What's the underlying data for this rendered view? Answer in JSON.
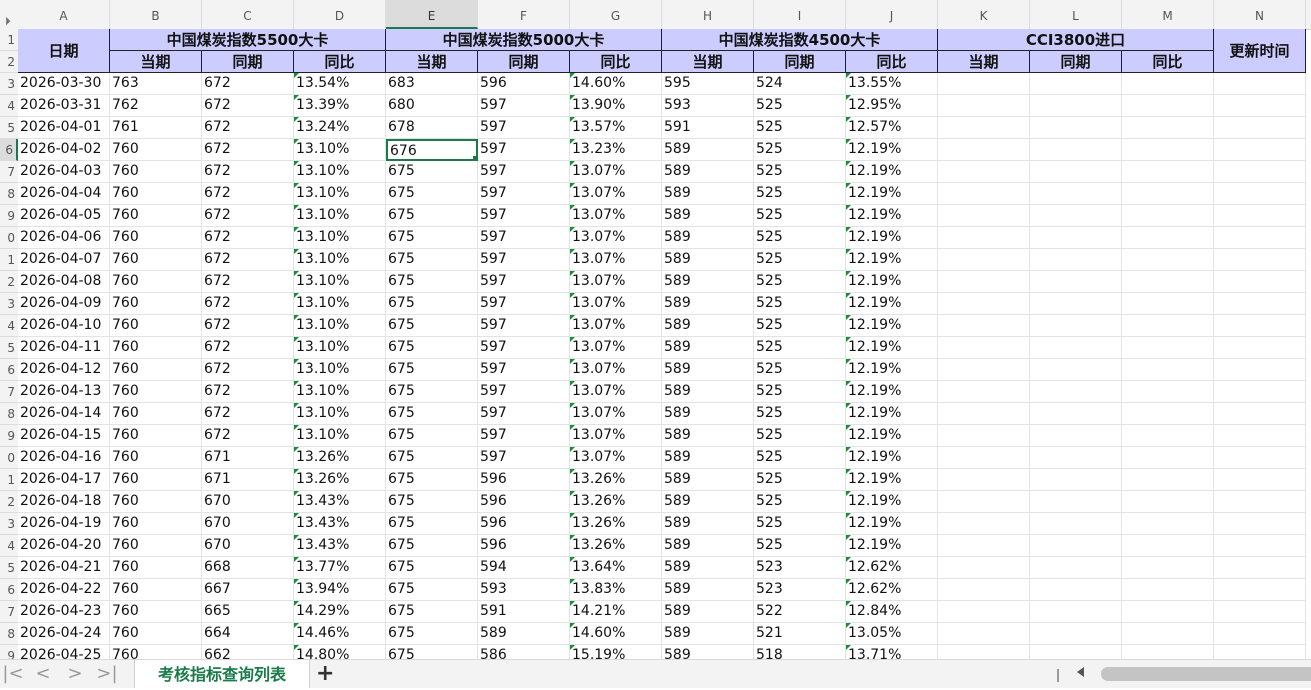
{
  "columns": [
    "A",
    "B",
    "C",
    "D",
    "E",
    "F",
    "G",
    "H",
    "I",
    "J",
    "K",
    "L",
    "M",
    "N"
  ],
  "selected_column": "E",
  "row_numbers": [
    "1",
    "2",
    "3",
    "4",
    "5",
    "6",
    "7",
    "8",
    "9",
    "0",
    "1",
    "2",
    "3",
    "4",
    "5",
    "6",
    "7",
    "8",
    "9",
    "0",
    "1",
    "2",
    "3",
    "4",
    "5",
    "6",
    "7",
    "8",
    "9"
  ],
  "selected_row_index": 5,
  "header": {
    "date": "日期",
    "group1": "中国煤炭指数5500大卡",
    "group2": "中国煤炭指数5000大卡",
    "group3": "中国煤炭指数4500大卡",
    "group4": "CCI3800进口",
    "update_time": "更新时间",
    "current": "当期",
    "same_period": "同期",
    "yoy": "同比"
  },
  "rows": [
    [
      "2026-03-30",
      "763",
      "672",
      "13.54%",
      "683",
      "596",
      "14.60%",
      "595",
      "524",
      "13.55%"
    ],
    [
      "2026-03-31",
      "762",
      "672",
      "13.39%",
      "680",
      "597",
      "13.90%",
      "593",
      "525",
      "12.95%"
    ],
    [
      "2026-04-01",
      "761",
      "672",
      "13.24%",
      "678",
      "597",
      "13.57%",
      "591",
      "525",
      "12.57%"
    ],
    [
      "2026-04-02",
      "760",
      "672",
      "13.10%",
      "676",
      "597",
      "13.23%",
      "589",
      "525",
      "12.19%"
    ],
    [
      "2026-04-03",
      "760",
      "672",
      "13.10%",
      "675",
      "597",
      "13.07%",
      "589",
      "525",
      "12.19%"
    ],
    [
      "2026-04-04",
      "760",
      "672",
      "13.10%",
      "675",
      "597",
      "13.07%",
      "589",
      "525",
      "12.19%"
    ],
    [
      "2026-04-05",
      "760",
      "672",
      "13.10%",
      "675",
      "597",
      "13.07%",
      "589",
      "525",
      "12.19%"
    ],
    [
      "2026-04-06",
      "760",
      "672",
      "13.10%",
      "675",
      "597",
      "13.07%",
      "589",
      "525",
      "12.19%"
    ],
    [
      "2026-04-07",
      "760",
      "672",
      "13.10%",
      "675",
      "597",
      "13.07%",
      "589",
      "525",
      "12.19%"
    ],
    [
      "2026-04-08",
      "760",
      "672",
      "13.10%",
      "675",
      "597",
      "13.07%",
      "589",
      "525",
      "12.19%"
    ],
    [
      "2026-04-09",
      "760",
      "672",
      "13.10%",
      "675",
      "597",
      "13.07%",
      "589",
      "525",
      "12.19%"
    ],
    [
      "2026-04-10",
      "760",
      "672",
      "13.10%",
      "675",
      "597",
      "13.07%",
      "589",
      "525",
      "12.19%"
    ],
    [
      "2026-04-11",
      "760",
      "672",
      "13.10%",
      "675",
      "597",
      "13.07%",
      "589",
      "525",
      "12.19%"
    ],
    [
      "2026-04-12",
      "760",
      "672",
      "13.10%",
      "675",
      "597",
      "13.07%",
      "589",
      "525",
      "12.19%"
    ],
    [
      "2026-04-13",
      "760",
      "672",
      "13.10%",
      "675",
      "597",
      "13.07%",
      "589",
      "525",
      "12.19%"
    ],
    [
      "2026-04-14",
      "760",
      "672",
      "13.10%",
      "675",
      "597",
      "13.07%",
      "589",
      "525",
      "12.19%"
    ],
    [
      "2026-04-15",
      "760",
      "672",
      "13.10%",
      "675",
      "597",
      "13.07%",
      "589",
      "525",
      "12.19%"
    ],
    [
      "2026-04-16",
      "760",
      "671",
      "13.26%",
      "675",
      "597",
      "13.07%",
      "589",
      "525",
      "12.19%"
    ],
    [
      "2026-04-17",
      "760",
      "671",
      "13.26%",
      "675",
      "596",
      "13.26%",
      "589",
      "525",
      "12.19%"
    ],
    [
      "2026-04-18",
      "760",
      "670",
      "13.43%",
      "675",
      "596",
      "13.26%",
      "589",
      "525",
      "12.19%"
    ],
    [
      "2026-04-19",
      "760",
      "670",
      "13.43%",
      "675",
      "596",
      "13.26%",
      "589",
      "525",
      "12.19%"
    ],
    [
      "2026-04-20",
      "760",
      "670",
      "13.43%",
      "675",
      "596",
      "13.26%",
      "589",
      "525",
      "12.19%"
    ],
    [
      "2026-04-21",
      "760",
      "668",
      "13.77%",
      "675",
      "594",
      "13.64%",
      "589",
      "523",
      "12.62%"
    ],
    [
      "2026-04-22",
      "760",
      "667",
      "13.94%",
      "675",
      "593",
      "13.83%",
      "589",
      "523",
      "12.62%"
    ],
    [
      "2026-04-23",
      "760",
      "665",
      "14.29%",
      "675",
      "591",
      "14.21%",
      "589",
      "522",
      "12.84%"
    ],
    [
      "2026-04-24",
      "760",
      "664",
      "14.46%",
      "675",
      "589",
      "14.60%",
      "589",
      "521",
      "13.05%"
    ],
    [
      "2026-04-25",
      "760",
      "662",
      "14.80%",
      "675",
      "586",
      "15.19%",
      "589",
      "518",
      "13.71%"
    ]
  ],
  "sheet_tab": "考核指标查询列表",
  "add_sheet": "+",
  "nav": {
    "first": "|<",
    "prev": "<",
    "next": ">",
    "last": ">|"
  },
  "colors": {
    "header_fill": "#ccccff",
    "accent": "#1a7a4a",
    "error_triangle": "#1f8a3a"
  }
}
